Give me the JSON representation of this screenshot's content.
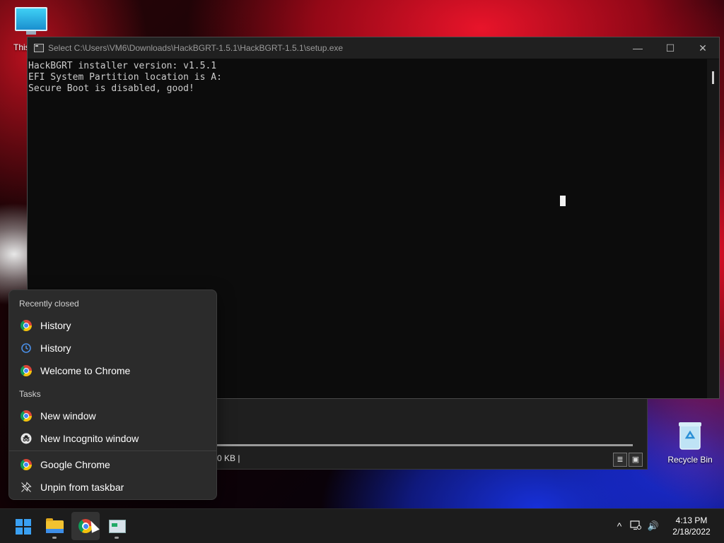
{
  "desktop": {
    "icons": [
      {
        "label": "This PC"
      },
      {
        "label": "Recycle Bin"
      }
    ]
  },
  "console": {
    "title": "Select C:\\Users\\VM6\\Downloads\\HackBGRT-1.5.1\\HackBGRT-1.5.1\\setup.exe",
    "lines": [
      "HackBGRT installer version: v1.5.1",
      "EFI System Partition location is A:",
      "Secure Boot is disabled, good!"
    ],
    "controls": {
      "minimize": "—",
      "maximize": "☐",
      "close": "✕"
    }
  },
  "explorer": {
    "status_text": "0 KB  |"
  },
  "jumplist": {
    "recently_closed_heading": "Recently closed",
    "recently_closed": [
      {
        "label": "History",
        "icon": "chrome-icon"
      },
      {
        "label": "History",
        "icon": "history-icon"
      },
      {
        "label": "Welcome to Chrome",
        "icon": "chrome-icon"
      }
    ],
    "tasks_heading": "Tasks",
    "tasks": [
      {
        "label": "New window",
        "icon": "chrome-icon"
      },
      {
        "label": "New Incognito window",
        "icon": "incognito-icon"
      }
    ],
    "app": {
      "label": "Google Chrome",
      "icon": "chrome-icon"
    },
    "unpin": {
      "label": "Unpin from taskbar",
      "icon": "unpin-icon"
    }
  },
  "taskbar": {
    "clock": {
      "time": "4:13 PM",
      "date": "2/18/2022"
    },
    "tray": {
      "overflow": "^",
      "volume": "🔊"
    }
  },
  "colors": {
    "console_bg": "#0c0c0c",
    "console_text": "#cccccc",
    "menu_bg": "#2b2b2b",
    "taskbar_bg": "#1c1c1c",
    "start_accent": "#3aa0f2"
  }
}
